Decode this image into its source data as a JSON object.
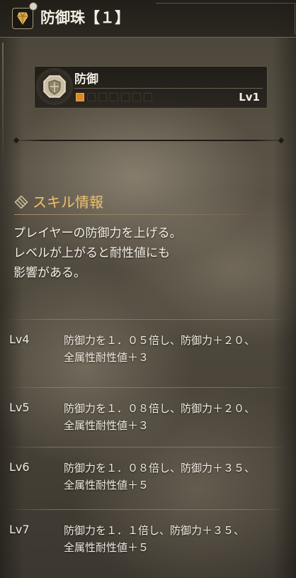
{
  "header": {
    "title": "防御珠【１】",
    "icon": "decoration-jewel-icon"
  },
  "decoration": {
    "icon": "defense-shield-icon",
    "skill_name": "防御",
    "level_text": "Lv1",
    "level_current": 1,
    "level_max": 7,
    "accent_color": "#d98a2b"
  },
  "skill_info": {
    "heading": "スキル情報",
    "icon": "skill-info-icon",
    "heading_color": "#f0c06a",
    "description_lines": [
      "プレイヤーの防御力を上げる。",
      "レベルが上がると耐性値にも",
      "影響がある。"
    ]
  },
  "levels": [
    {
      "label": "Lv4",
      "lines": [
        "防御力を１．０５倍し、防御力＋２０、",
        "全属性耐性値＋３"
      ]
    },
    {
      "label": "Lv5",
      "lines": [
        "防御力を１．０８倍し、防御力＋２０、",
        "全属性耐性値＋３"
      ]
    },
    {
      "label": "Lv6",
      "lines": [
        "防御力を１．０８倍し、防御力＋３５、",
        "全属性耐性値＋５"
      ]
    },
    {
      "label": "Lv7",
      "lines": [
        "防御力を１．１倍し、防御力＋３５、",
        "全属性耐性値＋５"
      ]
    }
  ]
}
